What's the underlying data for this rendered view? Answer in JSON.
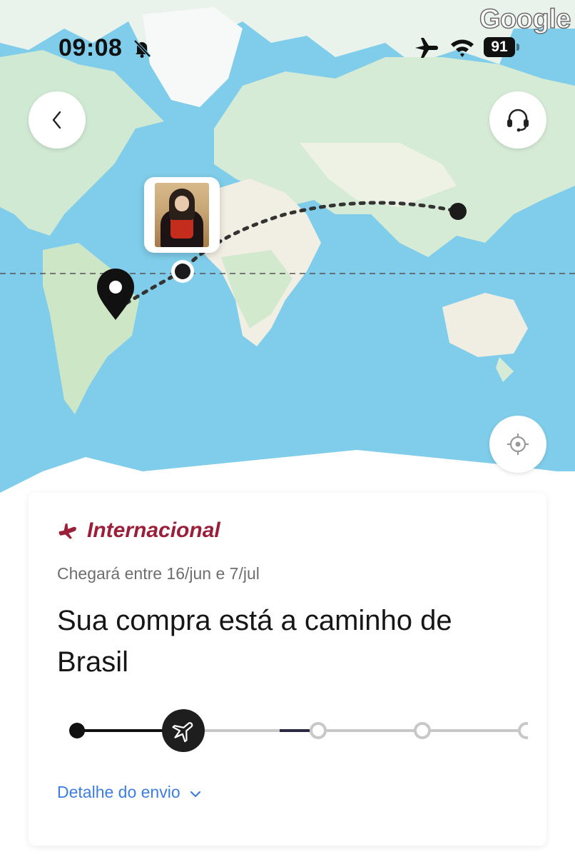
{
  "status_bar": {
    "time": "09:08",
    "battery": "91",
    "icons": [
      "bell-slash-icon",
      "airplane-mode-icon",
      "wifi-icon",
      "battery-icon"
    ]
  },
  "map": {
    "attribution": "Google",
    "colors": {
      "ocean": "#7fcdea",
      "land": "#d4ecd6",
      "desert": "#f2efe6",
      "ice": "#ffffff"
    }
  },
  "buttons": {
    "back_icon": "chevron-left-icon",
    "support_icon": "headset-icon",
    "locate_icon": "crosshair-icon"
  },
  "shipment": {
    "type_icon": "airplane-icon",
    "type_label": "Internacional",
    "eta": "Chegará entre 16/jun e 7/jul",
    "headline": "Sua compra está a caminho de Brasil",
    "progress": {
      "total_steps": 5,
      "current_step": 2,
      "current_icon": "airplane-icon"
    },
    "detail_link": "Detalhe do envio"
  },
  "colors": {
    "accent": "#9c1f3a",
    "link": "#3d7ee0",
    "track_done": "#111111",
    "track_pending": "#c8c8c8"
  }
}
